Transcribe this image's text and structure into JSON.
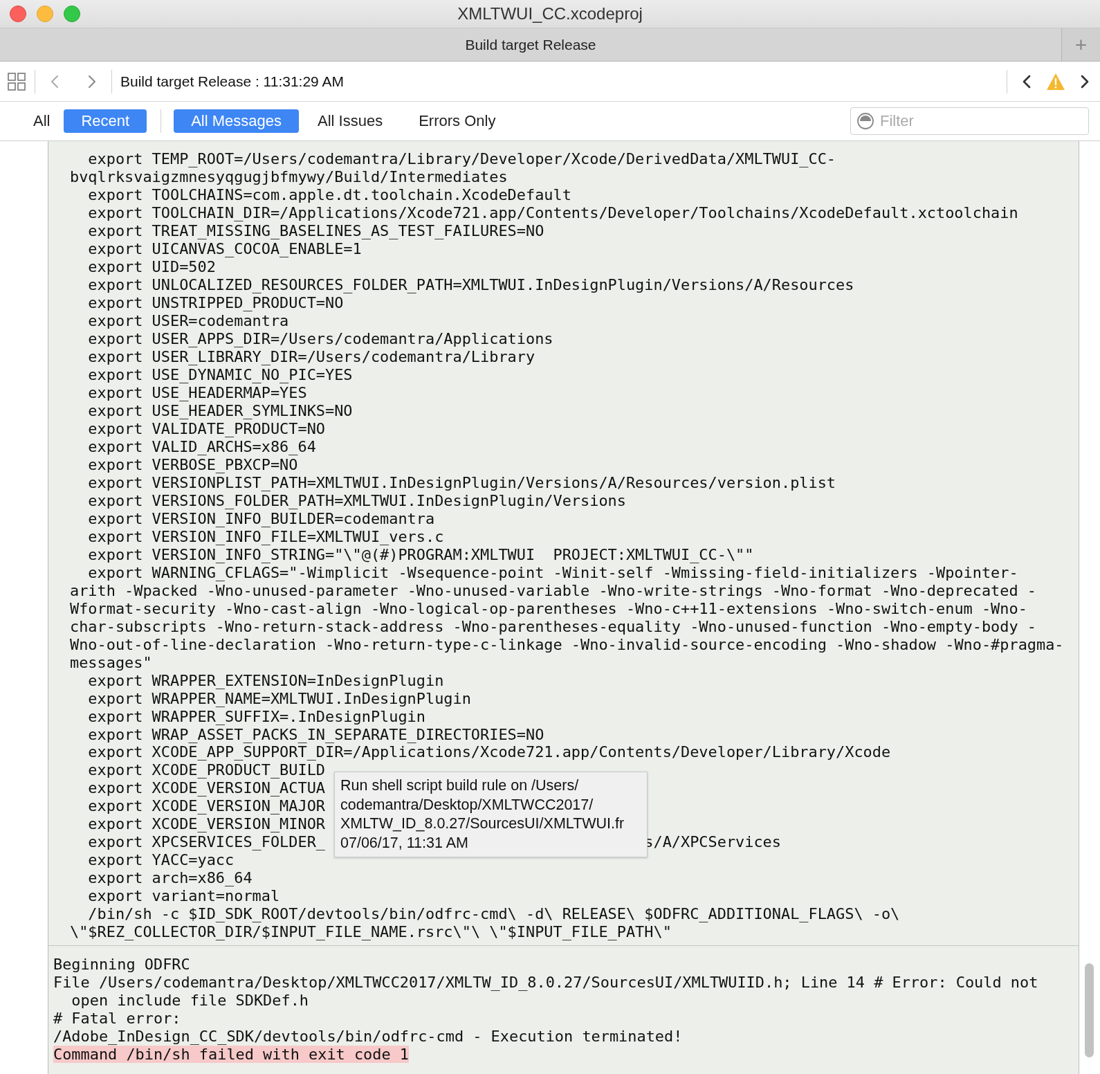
{
  "window": {
    "title": "XMLTWUI_CC.xcodeproj"
  },
  "tab_bar": {
    "tab": "Build target Release",
    "add_button": "+"
  },
  "navigation": {
    "breadcrumb": "Build target Release : 11:31:29 AM"
  },
  "scope_tabs": [
    {
      "label": "All",
      "selected": false
    },
    {
      "label": "Recent",
      "selected": true
    }
  ],
  "message_tabs": [
    {
      "label": "All Messages",
      "selected": true
    },
    {
      "label": "All Issues",
      "selected": false
    },
    {
      "label": "Errors Only",
      "selected": false
    }
  ],
  "filter": {
    "placeholder": "Filter"
  },
  "log": {
    "lines": [
      {
        "kind": "first",
        "text": "export TEMP_ROOT=/Users/codemantra/Library/Developer/Xcode/DerivedData/XMLTWUI_CC-"
      },
      {
        "kind": "cont",
        "text": "bvqlrksvaigzmnesyqgugjbfmywy/Build/Intermediates"
      },
      {
        "kind": "first",
        "text": "export TOOLCHAINS=com.apple.dt.toolchain.XcodeDefault"
      },
      {
        "kind": "first",
        "text": "export TOOLCHAIN_DIR=/Applications/Xcode721.app/Contents/Developer/Toolchains/XcodeDefault.xctoolchain"
      },
      {
        "kind": "first",
        "text": "export TREAT_MISSING_BASELINES_AS_TEST_FAILURES=NO"
      },
      {
        "kind": "first",
        "text": "export UICANVAS_COCOA_ENABLE=1"
      },
      {
        "kind": "first",
        "text": "export UID=502"
      },
      {
        "kind": "first",
        "text": "export UNLOCALIZED_RESOURCES_FOLDER_PATH=XMLTWUI.InDesignPlugin/Versions/A/Resources"
      },
      {
        "kind": "first",
        "text": "export UNSTRIPPED_PRODUCT=NO"
      },
      {
        "kind": "first",
        "text": "export USER=codemantra"
      },
      {
        "kind": "first",
        "text": "export USER_APPS_DIR=/Users/codemantra/Applications"
      },
      {
        "kind": "first",
        "text": "export USER_LIBRARY_DIR=/Users/codemantra/Library"
      },
      {
        "kind": "first",
        "text": "export USE_DYNAMIC_NO_PIC=YES"
      },
      {
        "kind": "first",
        "text": "export USE_HEADERMAP=YES"
      },
      {
        "kind": "first",
        "text": "export USE_HEADER_SYMLINKS=NO"
      },
      {
        "kind": "first",
        "text": "export VALIDATE_PRODUCT=NO"
      },
      {
        "kind": "first",
        "text": "export VALID_ARCHS=x86_64"
      },
      {
        "kind": "first",
        "text": "export VERBOSE_PBXCP=NO"
      },
      {
        "kind": "first",
        "text": "export VERSIONPLIST_PATH=XMLTWUI.InDesignPlugin/Versions/A/Resources/version.plist"
      },
      {
        "kind": "first",
        "text": "export VERSIONS_FOLDER_PATH=XMLTWUI.InDesignPlugin/Versions"
      },
      {
        "kind": "first",
        "text": "export VERSION_INFO_BUILDER=codemantra"
      },
      {
        "kind": "first",
        "text": "export VERSION_INFO_FILE=XMLTWUI_vers.c"
      },
      {
        "kind": "first",
        "text": "export VERSION_INFO_STRING=\"\\\"@(#)PROGRAM:XMLTWUI  PROJECT:XMLTWUI_CC-\\\"\""
      },
      {
        "kind": "first",
        "text": "export WARNING_CFLAGS=\"-Wimplicit -Wsequence-point -Winit-self -Wmissing-field-initializers -Wpointer-"
      },
      {
        "kind": "cont",
        "text": "arith -Wpacked -Wno-unused-parameter -Wno-unused-variable -Wno-write-strings -Wno-format -Wno-deprecated -"
      },
      {
        "kind": "cont",
        "text": "Wformat-security -Wno-cast-align -Wno-logical-op-parentheses -Wno-c++11-extensions -Wno-switch-enum -Wno-"
      },
      {
        "kind": "cont",
        "text": "char-subscripts -Wno-return-stack-address -Wno-parentheses-equality -Wno-unused-function -Wno-empty-body -"
      },
      {
        "kind": "cont",
        "text": "Wno-out-of-line-declaration -Wno-return-type-c-linkage -Wno-invalid-source-encoding -Wno-shadow -Wno-#pragma-"
      },
      {
        "kind": "cont",
        "text": "messages\""
      },
      {
        "kind": "first",
        "text": "export WRAPPER_EXTENSION=InDesignPlugin"
      },
      {
        "kind": "first",
        "text": "export WRAPPER_NAME=XMLTWUI.InDesignPlugin"
      },
      {
        "kind": "first",
        "text": "export WRAPPER_SUFFIX=.InDesignPlugin"
      },
      {
        "kind": "first",
        "text": "export WRAP_ASSET_PACKS_IN_SEPARATE_DIRECTORIES=NO"
      },
      {
        "kind": "first",
        "text": "export XCODE_APP_SUPPORT_DIR=/Applications/Xcode721.app/Contents/Developer/Library/Xcode"
      },
      {
        "kind": "first",
        "text": "export XCODE_PRODUCT_BUILD"
      },
      {
        "kind": "first",
        "text": "export XCODE_VERSION_ACTUA"
      },
      {
        "kind": "first",
        "text": "export XCODE_VERSION_MAJOR"
      },
      {
        "kind": "first",
        "text": "export XCODE_VERSION_MINOR"
      },
      {
        "kind": "first",
        "text": "export XPCSERVICES_FOLDER_",
        "tail": "s/A/XPCServices"
      },
      {
        "kind": "first",
        "text": "export YACC=yacc"
      },
      {
        "kind": "first",
        "text": "export arch=x86_64"
      },
      {
        "kind": "first",
        "text": "export variant=normal"
      },
      {
        "kind": "first",
        "text": "/bin/sh -c $ID_SDK_ROOT/devtools/bin/odfrc-cmd\\ -d\\ RELEASE\\ $ODFRC_ADDITIONAL_FLAGS\\ -o\\"
      },
      {
        "kind": "cont",
        "text": "\\\"$REZ_COLLECTOR_DIR/$INPUT_FILE_NAME.rsrc\\\"\\ \\\"$INPUT_FILE_PATH\\\""
      }
    ],
    "output": [
      {
        "kind": "first",
        "text": "Beginning ODFRC",
        "highlighted": false
      },
      {
        "kind": "first",
        "text": "File /Users/codemantra/Desktop/XMLTWCC2017/XMLTW_ID_8.0.27/SourcesUI/XMLTWUIID.h; Line 14 # Error: Could not",
        "highlighted": false
      },
      {
        "kind": "cont",
        "text": "open include file SDKDef.h",
        "highlighted": false
      },
      {
        "kind": "first",
        "text": "# Fatal error:",
        "highlighted": false
      },
      {
        "kind": "first",
        "text": "/Adobe_InDesign_CC_SDK/devtools/bin/odfrc-cmd - Execution terminated!",
        "highlighted": false
      },
      {
        "kind": "first",
        "text": "Command /bin/sh failed with exit code 1",
        "highlighted": true
      }
    ]
  },
  "tooltip": {
    "lines": [
      "Run shell script build rule on /Users/",
      "codemantra/Desktop/XMLTWCC2017/",
      "XMLTW_ID_8.0.27/SourcesUI/XMLTWUI.fr",
      "07/06/17, 11:31 AM"
    ]
  }
}
